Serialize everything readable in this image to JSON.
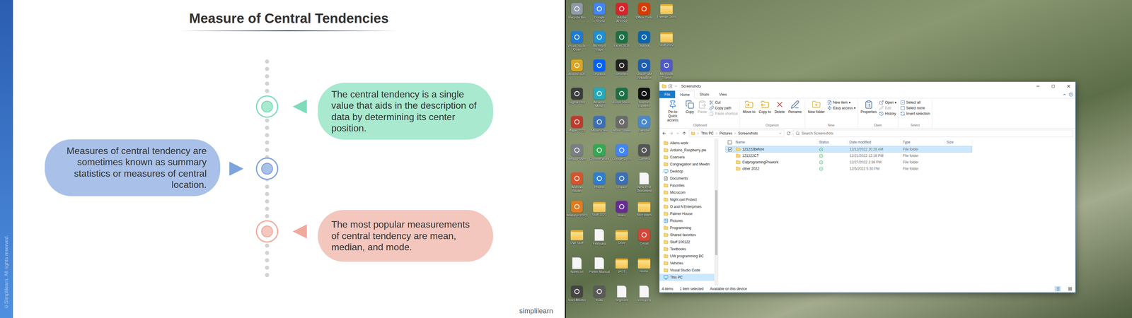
{
  "slide": {
    "strip_text": "©Simplilearn. All rights reserved.",
    "title": "Measure of Central Tendencies",
    "logo": "simplilearn",
    "notes": [
      {
        "text": "The central tendency is a single value that aids in the description of data by determining its center position.",
        "kind": "right",
        "color": "#a8e9cf",
        "accent": "#7fdcb8"
      },
      {
        "text": "Measures of central tendency are sometimes known as summary statistics or measures of central location.",
        "kind": "left",
        "color": "#a9c1e8",
        "accent": "#7fa3dc"
      },
      {
        "text": "The most popular measurements of central tendency are mean, median, and mode.",
        "kind": "right",
        "color": "#f3c7be",
        "accent": "#efaa9c"
      }
    ]
  },
  "desktop": {
    "icons": [
      {
        "label": "Recycle Bin",
        "kind": "app",
        "color": "#8e9aa8"
      },
      {
        "label": "Visual Studio Code",
        "kind": "app",
        "color": "#1f7ad6"
      },
      {
        "label": "Arduino IDE",
        "kind": "app",
        "color": "#d9a521"
      },
      {
        "label": "Sigma Plot",
        "kind": "app",
        "color": "#3b3b3b"
      },
      {
        "label": "Maple 2021",
        "kind": "app",
        "color": "#c0392b"
      },
      {
        "label": "Media Player",
        "kind": "app",
        "color": "#7a7f86"
      },
      {
        "label": "Android Studio",
        "kind": "app",
        "color": "#d9532b"
      },
      {
        "label": "Matlab R2022",
        "kind": "app",
        "color": "#e07a1f"
      },
      {
        "label": "UW Stuff",
        "kind": "folder"
      },
      {
        "label": "Notes.txt",
        "kind": "file"
      },
      {
        "label": "VoiceMeeter",
        "kind": "app",
        "color": "#444444"
      },
      {
        "label": "Google Chrome",
        "kind": "app",
        "color": "#4285f4"
      },
      {
        "label": "Microsoft Edge",
        "kind": "app",
        "color": "#1f8fd6"
      },
      {
        "label": "Dropbox",
        "kind": "app",
        "color": "#0061fe"
      },
      {
        "label": "Amazon Music",
        "kind": "app",
        "color": "#25a9ba"
      },
      {
        "label": "MuseScore",
        "kind": "app",
        "color": "#3b6fb6"
      },
      {
        "label": "Chrome Work",
        "kind": "app",
        "color": "#34a853"
      },
      {
        "label": "Photos",
        "kind": "app",
        "color": "#2d7dd2"
      },
      {
        "label": "Stuff 2021",
        "kind": "folder"
      },
      {
        "label": "Fiddy.jpg",
        "kind": "file"
      },
      {
        "label": "Printer Manual",
        "kind": "file"
      },
      {
        "label": "Kuta",
        "kind": "app",
        "color": "#5a5a5a"
      },
      {
        "label": "Adobe Acrobat",
        "kind": "app",
        "color": "#d6242b"
      },
      {
        "label": "Excel 2016",
        "kind": "app",
        "color": "#1d7044"
      },
      {
        "label": "Desmos",
        "kind": "app",
        "color": "#222222"
      },
      {
        "label": "Excel Sheet",
        "kind": "app",
        "color": "#1d7044"
      },
      {
        "label": "Music Sheet",
        "kind": "app",
        "color": "#6a6a6a"
      },
      {
        "label": "Google Docs",
        "kind": "app",
        "color": "#4285f4"
      },
      {
        "label": "LTspice",
        "kind": "app",
        "color": "#3b6fb6"
      },
      {
        "label": "Roku",
        "kind": "app",
        "color": "#662d91"
      },
      {
        "label": "Drive",
        "kind": "folder"
      },
      {
        "label": "pic11",
        "kind": "folder"
      },
      {
        "label": "Segment",
        "kind": "file"
      },
      {
        "label": "Office Tools",
        "kind": "app",
        "color": "#d83b01"
      },
      {
        "label": "Outlook",
        "kind": "app",
        "color": "#0a64ad"
      },
      {
        "label": "Oracle VM VirtualBox",
        "kind": "app",
        "color": "#1c5db0"
      },
      {
        "label": "Garmin Express",
        "kind": "app",
        "color": "#111111"
      },
      {
        "label": "Genshin",
        "kind": "app",
        "color": "#4b88c7"
      },
      {
        "label": "Camera",
        "kind": "app",
        "color": "#555555"
      },
      {
        "label": "New Text Document",
        "kind": "file"
      },
      {
        "label": "Bike plans",
        "kind": "folder"
      },
      {
        "label": "Gmail",
        "kind": "app",
        "color": "#d44638"
      },
      {
        "label": "Home",
        "kind": "folder"
      },
      {
        "label": "Icon.jpeg",
        "kind": "file"
      },
      {
        "label": "Freebie Docs",
        "kind": "folder"
      },
      {
        "label": "Stuff 2022",
        "kind": "folder"
      },
      {
        "label": "Microsoft Teams",
        "kind": "app",
        "color": "#5059c9"
      }
    ]
  },
  "explorer": {
    "window": {
      "title": "Screenshots"
    },
    "tabs": [
      {
        "label": "File",
        "kind": "menu",
        "selected": false
      },
      {
        "label": "Home",
        "kind": "tab",
        "selected": true
      },
      {
        "label": "Share",
        "kind": "tab",
        "selected": false
      },
      {
        "label": "View",
        "kind": "tab",
        "selected": false
      }
    ],
    "ribbon": {
      "groups": [
        {
          "label": "Clipboard",
          "large": [
            {
              "label": "Pin to Quick access",
              "disabled": false
            },
            {
              "label": "Copy",
              "disabled": false
            },
            {
              "label": "Paste",
              "disabled": true
            }
          ],
          "small": [
            {
              "label": "Cut",
              "disabled": false
            },
            {
              "label": "Copy path",
              "disabled": false
            },
            {
              "label": "Paste shortcut",
              "disabled": true
            }
          ]
        },
        {
          "label": "Organize",
          "large": [
            {
              "label": "Move to",
              "disabled": false
            },
            {
              "label": "Copy to",
              "disabled": false
            },
            {
              "label": "Delete",
              "disabled": false
            },
            {
              "label": "Rename",
              "disabled": false
            }
          ],
          "small": []
        },
        {
          "label": "New",
          "large": [
            {
              "label": "New folder",
              "disabled": false
            }
          ],
          "small": [
            {
              "label": "New item ▾",
              "disabled": false
            },
            {
              "label": "Easy access ▾",
              "disabled": false
            }
          ]
        },
        {
          "label": "Open",
          "large": [
            {
              "label": "Properties",
              "disabled": false
            }
          ],
          "small": [
            {
              "label": "Open ▾",
              "disabled": false
            },
            {
              "label": "Edit",
              "disabled": true
            },
            {
              "label": "History",
              "disabled": false
            }
          ]
        },
        {
          "label": "Select",
          "large": [],
          "small": [
            {
              "label": "Select all",
              "disabled": false
            },
            {
              "label": "Select none",
              "disabled": false
            },
            {
              "label": "Invert selection",
              "disabled": false
            }
          ]
        }
      ]
    },
    "address": {
      "crumbs": [
        "This PC",
        "Pictures",
        "Screenshots"
      ]
    },
    "search": {
      "placeholder": "Search Screenshots"
    },
    "nav": {
      "items": [
        {
          "label": "Allens work",
          "kind": "folder",
          "selected": false
        },
        {
          "label": "Arduino_Raspberry pie",
          "kind": "folder",
          "selected": false
        },
        {
          "label": "Coarsera",
          "kind": "folder",
          "selected": false
        },
        {
          "label": "Congregation and Meetin",
          "kind": "folder",
          "selected": false
        },
        {
          "label": "Desktop",
          "kind": "desktop",
          "selected": false
        },
        {
          "label": "Documents",
          "kind": "documents",
          "selected": false
        },
        {
          "label": "Favorites",
          "kind": "folder",
          "selected": false
        },
        {
          "label": "Microcom",
          "kind": "folder",
          "selected": false
        },
        {
          "label": "Night owl Protect",
          "kind": "folder",
          "selected": false
        },
        {
          "label": "O and A Enterprises",
          "kind": "folder",
          "selected": false
        },
        {
          "label": "Palmer House",
          "kind": "folder",
          "selected": false
        },
        {
          "label": "Pictures",
          "kind": "pictures",
          "selected": false
        },
        {
          "label": "Programming",
          "kind": "folder",
          "selected": false
        },
        {
          "label": "Shared favorites",
          "kind": "folder",
          "selected": false
        },
        {
          "label": "Stuff 100122",
          "kind": "folder",
          "selected": false
        },
        {
          "label": "Textbooks",
          "kind": "folder",
          "selected": false
        },
        {
          "label": "UW programming BC",
          "kind": "folder",
          "selected": false
        },
        {
          "label": "Vehicles",
          "kind": "folder",
          "selected": false
        },
        {
          "label": "Visual Studio Code",
          "kind": "folder",
          "selected": false
        },
        {
          "label": "This PC",
          "kind": "pc",
          "selected": true
        }
      ]
    },
    "table": {
      "select_all_checked": false,
      "columns": [
        "Name",
        "Status",
        "Date modified",
        "Type",
        "Size"
      ],
      "rows": [
        {
          "name": "121222before",
          "synced": true,
          "date": "12/12/2022 10:28 AM",
          "type": "File folder",
          "size": "",
          "selected": true,
          "checked": true
        },
        {
          "name": "121222CT",
          "synced": true,
          "date": "12/21/2022 12:16 PM",
          "type": "File folder",
          "size": "",
          "selected": false,
          "checked": false
        },
        {
          "name": "CalprogramingPrework",
          "synced": true,
          "date": "12/27/2022 1:38 PM",
          "type": "File folder",
          "size": "",
          "selected": false,
          "checked": false
        },
        {
          "name": "other 2022",
          "synced": true,
          "date": "12/5/2022 5:30 PM",
          "type": "File folder",
          "size": "",
          "selected": false,
          "checked": false
        }
      ]
    },
    "status_bar": {
      "count": "4 items",
      "selection": "1 item selected",
      "availability": "Available on this device"
    }
  }
}
